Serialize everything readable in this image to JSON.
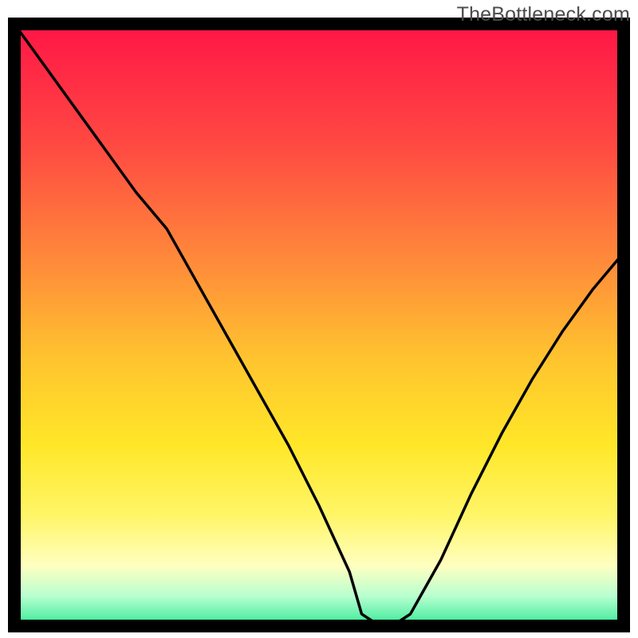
{
  "watermark": "TheBottleneck.com",
  "chart_data": {
    "type": "line",
    "title": "",
    "xlabel": "",
    "ylabel": "",
    "xlim": [
      0,
      100
    ],
    "ylim": [
      0,
      100
    ],
    "x": [
      0,
      5,
      10,
      15,
      20,
      25,
      30,
      35,
      40,
      45,
      50,
      55,
      57,
      60,
      62,
      65,
      70,
      75,
      80,
      85,
      90,
      95,
      100
    ],
    "values": [
      100,
      93,
      86,
      79,
      72,
      66,
      57,
      48,
      39,
      30,
      20,
      9,
      2,
      0,
      0,
      2,
      11,
      22,
      32,
      41,
      49,
      56,
      62
    ],
    "marker": {
      "x": 61,
      "y": 0,
      "color": "#e37c7c"
    },
    "background": {
      "type": "vertical-gradient",
      "stops": [
        {
          "pos": 0.0,
          "color": "#ff1547"
        },
        {
          "pos": 0.2,
          "color": "#ff4942"
        },
        {
          "pos": 0.4,
          "color": "#ff8c3a"
        },
        {
          "pos": 0.55,
          "color": "#ffc22f"
        },
        {
          "pos": 0.7,
          "color": "#ffe728"
        },
        {
          "pos": 0.82,
          "color": "#fff66a"
        },
        {
          "pos": 0.9,
          "color": "#ffffc0"
        },
        {
          "pos": 0.95,
          "color": "#b8ffd0"
        },
        {
          "pos": 0.985,
          "color": "#5df0a8"
        },
        {
          "pos": 1.0,
          "color": "#19e189"
        }
      ]
    },
    "frame_color": "#000000"
  }
}
